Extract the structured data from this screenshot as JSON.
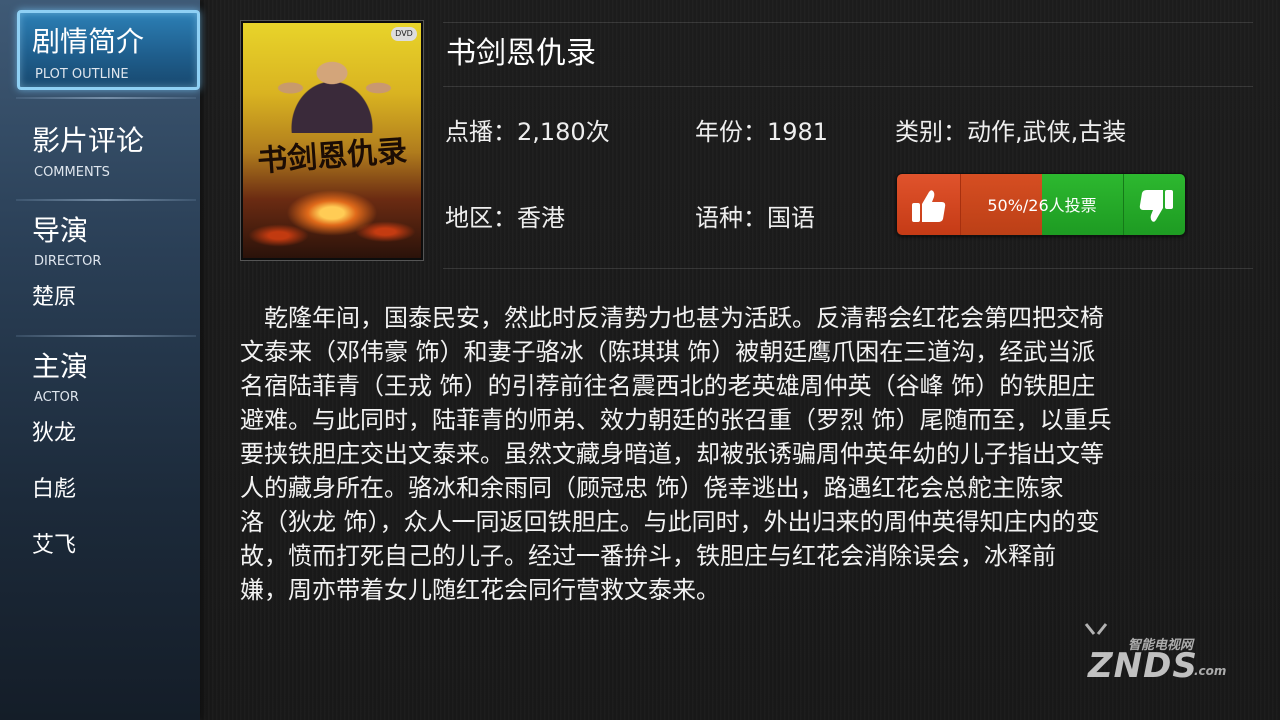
{
  "sidebar": {
    "items": [
      {
        "title": "剧情简介",
        "subtitle": "PLOT OUTLINE"
      },
      {
        "title": "影片评论",
        "subtitle": "COMMENTS"
      },
      {
        "title": "导演",
        "subtitle": "DIRECTOR",
        "names": [
          "楚原"
        ]
      },
      {
        "title": "主演",
        "subtitle": "ACTOR",
        "names": [
          "狄龙",
          "白彪",
          "艾飞"
        ]
      }
    ]
  },
  "poster": {
    "title_art": "书剑恩仇录",
    "badge": "DVD"
  },
  "movie": {
    "title": "书剑恩仇录",
    "plays": "点播：2,180次",
    "year": "年份：1981",
    "genre": "类别：动作,武侠,古装",
    "region": "地区：香港",
    "language": "语种：国语"
  },
  "vote": {
    "label": "50%/26人投票",
    "up_percent": 50,
    "up_color": "#d64e22",
    "down_color": "#2db82f",
    "up_icon": "thumbs-up-icon",
    "down_icon": "thumbs-down-icon"
  },
  "synopsis": {
    "lines": [
      "　乾隆年间，国泰民安，然此时反清势力也甚为活跃。反清帮会红花会第四把交椅",
      "文泰来（邓伟豪 饰）和妻子骆冰（陈琪琪 饰）被朝廷鹰爪困在三道沟，经武当派",
      "名宿陆菲青（王戎 饰）的引荐前往名震西北的老英雄周仲英（谷峰 饰）的铁胆庄",
      "避难。与此同时，陆菲青的师弟、效力朝廷的张召重（罗烈 饰）尾随而至，以重兵",
      "要挟铁胆庄交出文泰来。虽然文藏身暗道，却被张诱骗周仲英年幼的儿子指出文等",
      "人的藏身所在。骆冰和余雨同（顾冠忠 饰）侥幸逃出，路遇红花会总舵主陈家",
      "洛（狄龙 饰），众人一同返回铁胆庄。与此同时，外出归来的周仲英得知庄内的变",
      "故，愤而打死自己的儿子。经过一番拚斗，铁胆庄与红花会消除误会，冰释前",
      "嫌，周亦带着女儿随红花会同行营救文泰来。"
    ]
  },
  "watermark": {
    "cn": "智能电视网",
    "en": "ZNDS",
    "suffix": ".com"
  }
}
